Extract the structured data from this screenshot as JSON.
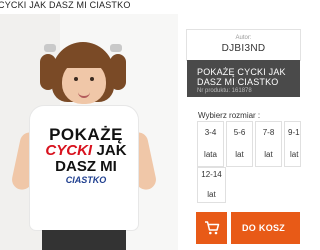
{
  "product": {
    "title_top": "CYCKI JAK DASZ MI CIASTKO",
    "author_label": "Autor:",
    "author_name": "DJBI3ND",
    "name": "POKAŻĘ CYCKI JAK DASZ MI CIASTKO",
    "number": "Nr produktu: 161878",
    "print_lines": [
      "POKAŻĘ",
      "CYCKI",
      "JAK",
      "DASZ MI",
      "CIASTKO"
    ]
  },
  "sizes": {
    "label": "Wybierz rozmiar :",
    "options": [
      {
        "value": "3-4",
        "unit": "lata"
      },
      {
        "value": "5-6",
        "unit": "lat"
      },
      {
        "value": "7-8",
        "unit": "lat"
      },
      {
        "value": "9-1",
        "unit": "lat"
      },
      {
        "value": "12-14",
        "unit": "lat"
      }
    ]
  },
  "cart": {
    "button_label": "DO KOSZ",
    "icon": "cart-icon"
  },
  "colors": {
    "accent": "#e85a17",
    "dark_panel": "#4a4a4a",
    "print_red": "#d8121e",
    "print_blue": "#1f3f8f"
  }
}
